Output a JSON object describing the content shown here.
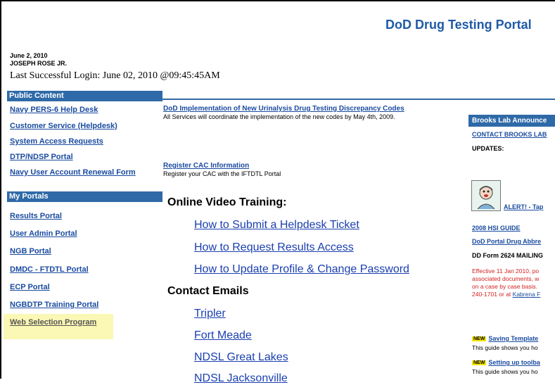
{
  "header": {
    "portal_title": "DoD Drug Testing Portal",
    "date": "June 2, 2010",
    "user_name": "JOSEPH ROSE JR.",
    "last_login": "Last Successful Login: June 02, 2010 @09:45:45AM"
  },
  "sidebar": {
    "public_header": "Public Content",
    "public_links": [
      "Navy PERS-6 Help Desk",
      "Customer Service (Helpdesk)",
      "System Access Requests",
      "DTP/NDSP Portal",
      "Navy User Account Renewal Form"
    ],
    "portals_header": "My Portals",
    "portal_links": [
      "Results Portal",
      "User Admin Portal",
      "NGB Portal",
      "DMDC - FTDTL Portal",
      "ECP Portal",
      "NGBDTP Training Portal",
      "Web Selection Program"
    ]
  },
  "main": {
    "news1_link": "DoD Implementation of New Urinalysis Drug Testing Discrepancy Codes",
    "news1_desc": "All Services will coordinate the implementation of the new codes by May 4th, 2009.",
    "news2_link": "Register CAC Information",
    "news2_desc": "Register your CAC with the IFTDTL Portal",
    "video_heading": "Online Video Training:",
    "video_links": [
      "How to Submit a Helpdesk Ticket",
      "How to Request Results Access",
      "How to Update Profile & Change Password"
    ],
    "contact_heading": "Contact Emails",
    "contact_links": [
      "Tripler",
      "Fort Meade",
      "NDSL Great Lakes",
      "NDSL Jacksonville"
    ]
  },
  "right": {
    "box_title": "Brooks Lab Announce",
    "contact_link": "CONTACT BROOKS LAB",
    "updates": "UPDATES:",
    "alert_link": "ALERT! - Tap",
    "hsi_guide": "2008 HSI GUIDE",
    "drug_abbr": "DoD Portal Drug Abbre",
    "dd_form": "DD Form 2624 MAILING",
    "red_lines": [
      "Effective 11 Jan 2010, po",
      "associated documents, w",
      "on a case by case basis.",
      "240-1701 or at "
    ],
    "red_link": "Kabrena F",
    "new_badge": "NEW",
    "saving_link": "Saving Template",
    "saving_desc": "This guide shows you ho",
    "toolbar_link": "Setting up toolba",
    "toolbar_desc": "This guide shows you ho"
  },
  "colors": {
    "header_blue": "#2f6aa8",
    "title_blue": "#1f5aa6",
    "link_blue": "#1a4ba0",
    "highlight": "#fbf7b4",
    "red": "#d42020"
  }
}
